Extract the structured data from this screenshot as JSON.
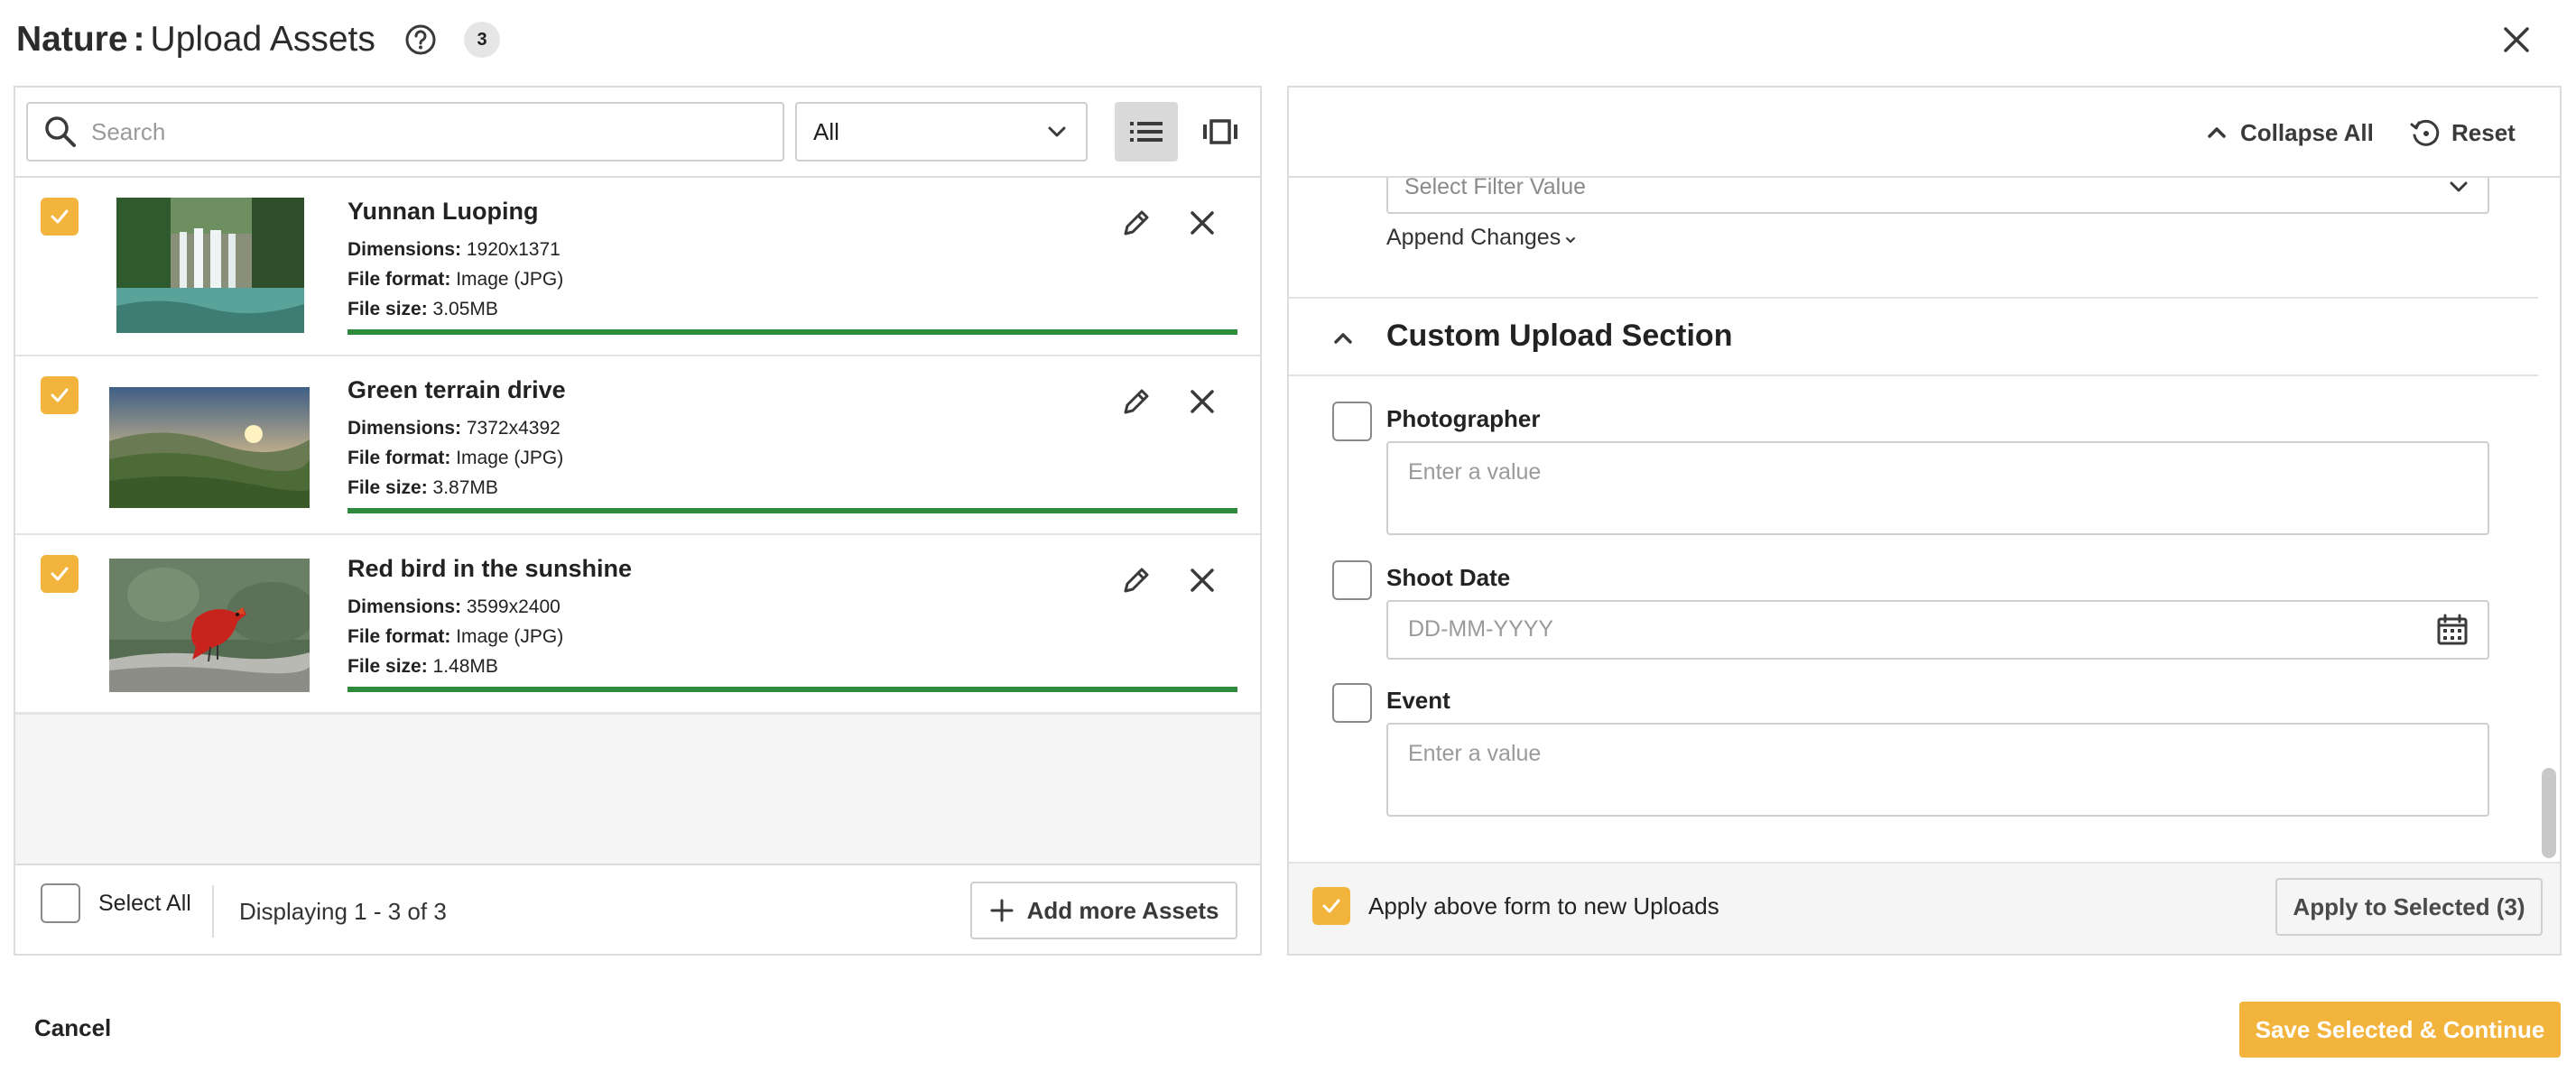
{
  "header": {
    "collection": "Nature",
    "separator": ":",
    "title": "Upload Assets",
    "count_badge": "3"
  },
  "toolbar": {
    "search_placeholder": "Search",
    "filter_value": "All"
  },
  "assets": [
    {
      "name": "Yunnan Luoping",
      "dimensions_label": "Dimensions:",
      "dimensions": "1920x1371",
      "format_label": "File format:",
      "format": "Image (JPG)",
      "size_label": "File size:",
      "size": "3.05MB",
      "checked": true,
      "progress": 1.0
    },
    {
      "name": "Green terrain drive",
      "dimensions_label": "Dimensions:",
      "dimensions": "7372x4392",
      "format_label": "File format:",
      "format": "Image (JPG)",
      "size_label": "File size:",
      "size": "3.87MB",
      "checked": true,
      "progress": 1.0
    },
    {
      "name": "Red bird in the sunshine",
      "dimensions_label": "Dimensions:",
      "dimensions": "3599x2400",
      "format_label": "File format:",
      "format": "Image (JPG)",
      "size_label": "File size:",
      "size": "1.48MB",
      "checked": true,
      "progress": 1.0
    }
  ],
  "left_footer": {
    "select_all": "Select All",
    "displaying": "Displaying 1 - 3 of 3",
    "add_more": "Add more Assets"
  },
  "right_toolbar": {
    "collapse_all": "Collapse All",
    "reset": "Reset"
  },
  "metadata_form": {
    "filter_placeholder": "Select Filter Value",
    "append_changes": "Append Changes",
    "section_title": "Custom Upload Section",
    "fields": [
      {
        "label": "Photographer",
        "placeholder": "Enter a value"
      },
      {
        "label": "Shoot Date",
        "placeholder": "DD-MM-YYYY"
      },
      {
        "label": "Event",
        "placeholder": "Enter a value"
      }
    ]
  },
  "right_footer": {
    "apply_form_label": "Apply above form to new Uploads",
    "apply_form_checked": true,
    "apply_selected": "Apply to Selected (3)"
  },
  "actions": {
    "cancel": "Cancel",
    "save": "Save Selected & Continue"
  },
  "colors": {
    "accent": "#f3b43e",
    "progress": "#2e8b3e",
    "border": "#dcdcdc"
  }
}
